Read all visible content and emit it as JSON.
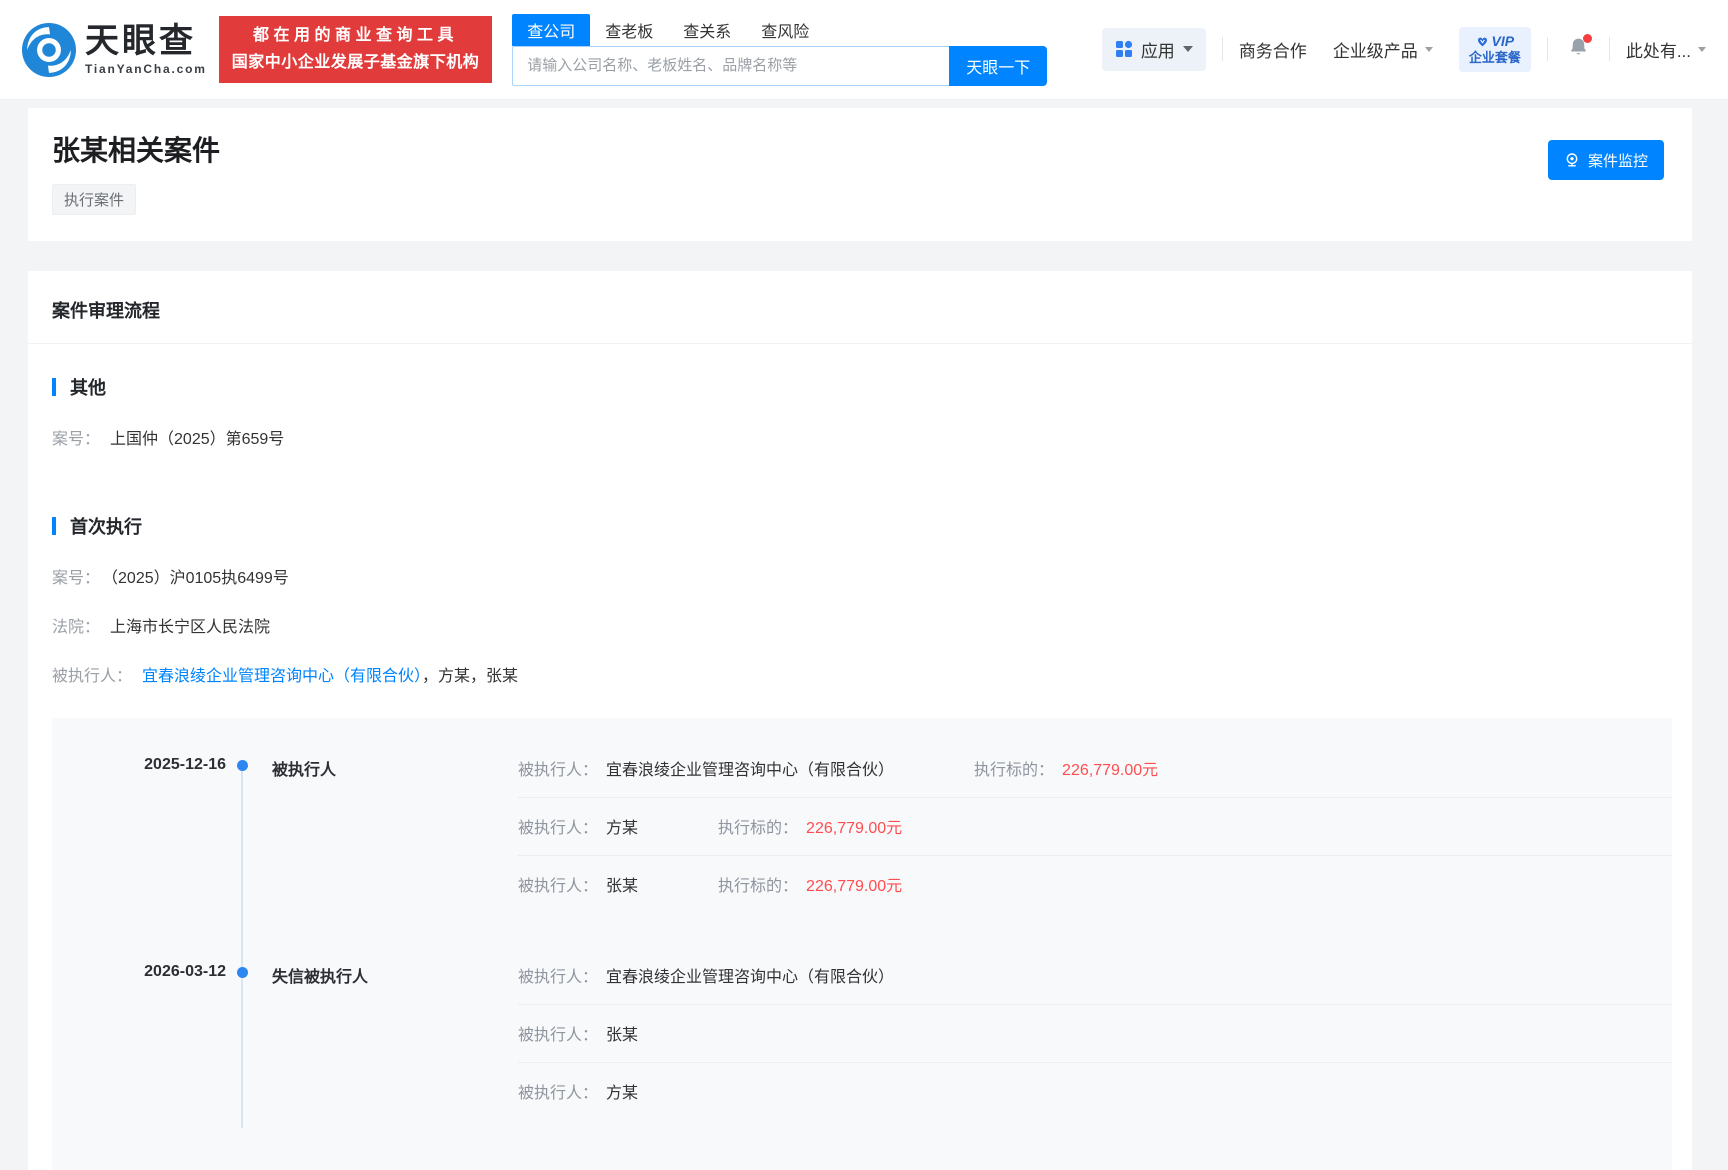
{
  "brand": {
    "logo_text": "天眼查",
    "logo_domain": "TianYanCha.com",
    "slogan_line1": "都在用的商业查询工具",
    "slogan_line2": "国家中小企业发展子基金旗下机构"
  },
  "search": {
    "tabs": [
      {
        "label": "查公司",
        "active": true
      },
      {
        "label": "查老板",
        "active": false
      },
      {
        "label": "查关系",
        "active": false
      },
      {
        "label": "查风险",
        "active": false
      }
    ],
    "placeholder": "请输入公司名称、老板姓名、品牌名称等",
    "button_label": "天眼一下"
  },
  "nav": {
    "apps_label": "应用",
    "business_label": "商务合作",
    "enterprise_label": "企业级产品",
    "vip_line1": "VIP",
    "vip_line2": "企业套餐",
    "user_label": "此处有..."
  },
  "page": {
    "title": "张某相关案件",
    "tag": "执行案件",
    "monitor_button": "案件监控"
  },
  "case_flow": {
    "heading": "案件审理流程",
    "sections": [
      {
        "title": "其他",
        "fields": [
          {
            "label": "案号：",
            "value": "上国仲（2025）第659号"
          }
        ]
      },
      {
        "title": "首次执行",
        "fields": [
          {
            "label": "案号：",
            "value": "（2025）沪0105执6499号"
          },
          {
            "label": "法院：",
            "value": "上海市长宁区人民法院"
          },
          {
            "label": "被执行人：",
            "link": "宜春浪绫企业管理咨询中心（有限合伙）",
            "rest": "，方某，张某"
          }
        ]
      }
    ]
  },
  "timeline": {
    "groups": [
      {
        "date": "2025-12-16",
        "label": "被执行人",
        "rows": [
          {
            "label": "被执行人：",
            "name": "宜春浪绫企业管理咨询中心（有限合伙）",
            "amount_label": "执行标的：",
            "amount": "226,779.00元"
          },
          {
            "label": "被执行人：",
            "name": "方某",
            "amount_label": "执行标的：",
            "amount": "226,779.00元"
          },
          {
            "label": "被执行人：",
            "name": "张某",
            "amount_label": "执行标的：",
            "amount": "226,779.00元"
          }
        ]
      },
      {
        "date": "2026-03-12",
        "label": "失信被执行人",
        "rows": [
          {
            "label": "被执行人：",
            "name": "宜春浪绫企业管理咨询中心（有限合伙）"
          },
          {
            "label": "被执行人：",
            "name": "张某"
          },
          {
            "label": "被执行人：",
            "name": "方某"
          }
        ]
      }
    ]
  },
  "colors": {
    "primary_blue": "#0084ff",
    "link_blue": "#0084ff",
    "amount_red": "#ff4d4f",
    "badge_red": "#e23b3b",
    "vip_blue": "#2a66c8",
    "page_bg": "#f3f4f5",
    "timeline_bg": "#f8f9fb"
  }
}
